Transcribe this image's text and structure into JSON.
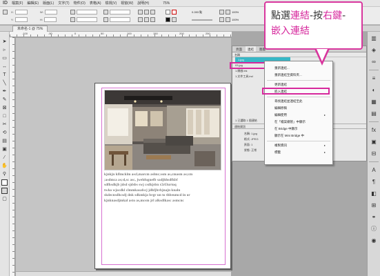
{
  "app": {
    "logo": "ID"
  },
  "menubar": {
    "items": [
      "檔案(F)",
      "編輯(E)",
      "版面(L)",
      "文字(T)",
      "物件(O)",
      "表格(A)",
      "檢視(V)",
      "視窗(W)",
      "說明(H)"
    ],
    "zoom": "75%"
  },
  "controlbar": {
    "labels": {
      "x": "X:",
      "y": "Y:",
      "w": "W:",
      "h": "H:"
    },
    "stroke_value": "0.283 點",
    "percent_a": "100%",
    "percent_b": "100%"
  },
  "document": {
    "tab_label": "未命名-1 @ 75%"
  },
  "ruler": {
    "h_numbers": [
      "-100",
      "-50",
      "0",
      "50",
      "100",
      "150",
      "200",
      "250"
    ]
  },
  "page_text": {
    "lines": [
      "kjnkjn kflmcklm ascl,marcm aslmc;ssm as,cmasm as;cm",
      ";asdmca as;sl,sc asc, jwehfuguefb sadjhhsdfkbf",
      "sdfhsdkjb jdsd sjdsbs swj csdkjsbn r2rl3urtoq",
      "twko wjocdkl clmmkasafscj jdhfjhvbjnajn knaln",
      "skdecnsdhcsdj dnk sdkmkja brgr un to thbeumcd in or",
      "kjnknasdjmkal asto as,mcsm jrl alksdlkasc asmcnc"
    ]
  },
  "panel": {
    "tabs": [
      "頁面",
      "連結",
      "圖層"
    ],
    "active_tab": "連結",
    "column_header": "名稱",
    "links": [
      "1.jpg",
      "03.jpg",
      "1.開啟.lnk",
      "1.文件工具.ind"
    ],
    "selected_link": "1.jpg",
    "footer_label": "1 已選取 1 個連結",
    "info_header": "連結資訊",
    "info_rows": [
      {
        "key": "名稱:",
        "value": "1.jpg"
      },
      {
        "key": "格式:",
        "value": "JPEG"
      },
      {
        "key": "頁面:",
        "value": "1"
      },
      {
        "key": "狀態:",
        "value": "正常"
      }
    ]
  },
  "context_menu": {
    "items": [
      {
        "label": "重新連結...",
        "submenu": false
      },
      {
        "label": "重新連結至資料夾...",
        "submenu": false
      },
      {
        "label": "更新連結",
        "submenu": false
      },
      {
        "label": "嵌入連結",
        "submenu": false
      },
      {
        "label": "尋找連結並連結至此",
        "submenu": false
      },
      {
        "label": "編輯原稿",
        "submenu": false
      },
      {
        "label": "編輯使用",
        "submenu": true
      },
      {
        "label": "在「檔案總管」中顯示",
        "submenu": false
      },
      {
        "label": "在 Bridge 中顯示",
        "submenu": false
      },
      {
        "label": "顯示在 Mini Bridge 中",
        "submenu": false
      },
      {
        "label": "複製資訊",
        "submenu": true
      },
      {
        "label": "標籤",
        "submenu": true
      }
    ],
    "highlighted": "嵌入連結"
  },
  "callout": {
    "line1_a": "點選",
    "line1_b": "連結",
    "line1_c": "-按",
    "line1_d": "右鍵",
    "line1_e": "-",
    "line2": "嵌入連結"
  },
  "colors": {
    "accent_pink": "#d6279c",
    "selection_cyan": "#38b7c6",
    "margin_guide": "#d66fd0"
  },
  "toolbox": {
    "icons": [
      "selection-tool-icon",
      "direct-selection-tool-icon",
      "page-tool-icon",
      "gap-tool-icon",
      "type-tool-icon",
      "line-tool-icon",
      "pen-tool-icon",
      "pencil-tool-icon",
      "rectangle-frame-tool-icon",
      "rectangle-tool-icon",
      "scissors-tool-icon",
      "free-transform-tool-icon",
      "gradient-tool-icon",
      "note-tool-icon",
      "eyedropper-tool-icon",
      "hand-tool-icon",
      "zoom-tool-icon"
    ]
  },
  "dock": {
    "icons": [
      "pages-panel-icon",
      "layers-panel-icon",
      "links-panel-icon",
      "stroke-panel-icon",
      "color-panel-icon",
      "swatches-panel-icon",
      "gradient-panel-icon",
      "effects-panel-icon",
      "text-wrap-panel-icon",
      "align-panel-icon",
      "character-panel-icon",
      "paragraph-panel-icon",
      "object-styles-panel-icon",
      "table-panel-icon",
      "hyperlinks-panel-icon",
      "info-panel-icon",
      "tint-panel-icon"
    ]
  }
}
